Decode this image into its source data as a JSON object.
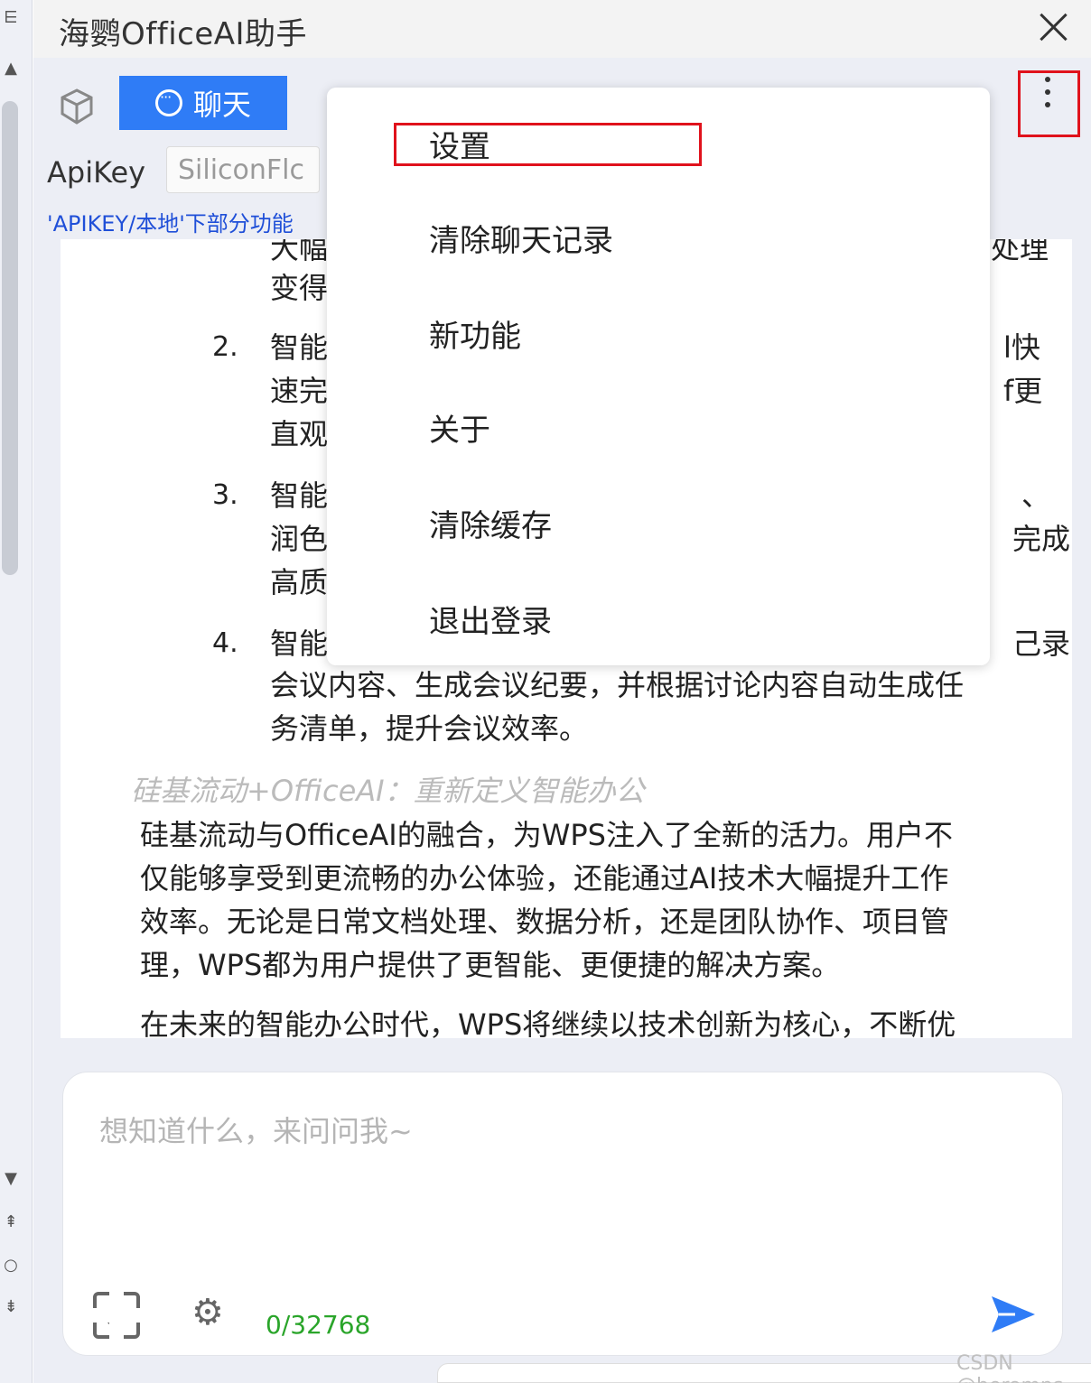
{
  "window": {
    "title": "海鹦OfficeAI助手"
  },
  "toolbar": {
    "chat_tab_label": "聊天"
  },
  "config": {
    "apikey_label": "ApiKey",
    "apikey_value": "SiliconFlc",
    "notice": "'APIKEY/本地'下部分功能"
  },
  "menu": {
    "items": [
      "设置",
      "清除聊天记录",
      "新功能",
      "关于",
      "清除缓存",
      "退出登录"
    ]
  },
  "content": {
    "list": [
      {
        "num": "",
        "lines": [
          "大幅",
          "变得"
        ]
      },
      {
        "num": "2.",
        "lines": [
          "智能",
          "速完",
          "直观"
        ]
      },
      {
        "num": "3.",
        "lines": [
          "智能",
          "润色",
          "高质"
        ]
      },
      {
        "num": "4.",
        "lines": [
          "智能",
          "会议内容、生成会议纪要，并根据讨论内容自动生成任",
          "务清单，提升会议效率。"
        ]
      }
    ],
    "right_fragments": [
      "处理",
      "l快",
      "f更",
      "、",
      "完成",
      "己录"
    ],
    "section_heading": "硅基流动+OfficeAI：重新定义智能办公",
    "paragraph1": [
      "硅基流动与OfficeAI的融合，为WPS注入了全新的活力。用户不",
      "仅能够享受到更流畅的办公体验，还能通过AI技术大幅提升工作",
      "效率。无论是日常文档处理、数据分析，还是团队协作、项目管",
      "理，WPS都为用户提供了更智能、更便捷的解决方案。"
    ],
    "paragraph2": "在未来的智能办公时代，WPS将继续以技术创新为核心，不断优"
  },
  "input": {
    "placeholder": "想知道什么，来问问我~",
    "counter": "0/32768"
  },
  "watermark": "CSDN @heromps",
  "colors": {
    "accent": "#2f7cf6",
    "highlight": "#e0121c",
    "counter": "#2aa52a",
    "notice": "#1f4fd8"
  }
}
